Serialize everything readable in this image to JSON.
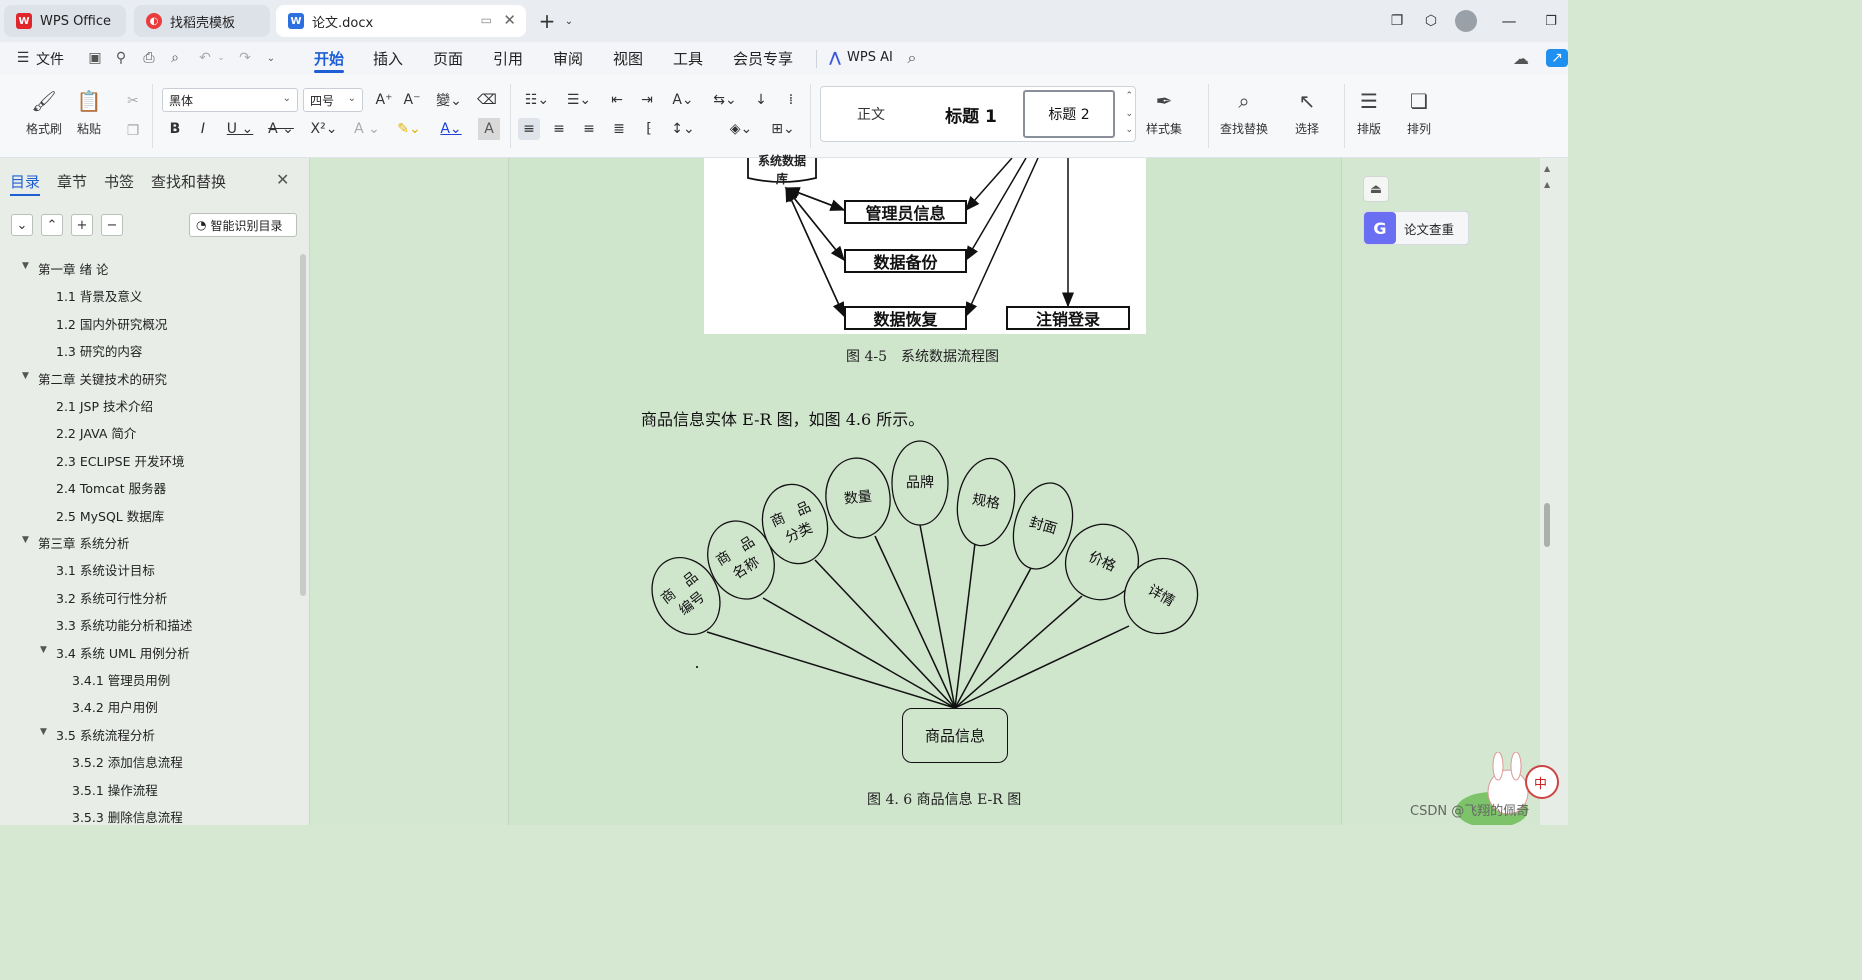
{
  "titlebar": {
    "tabs": [
      {
        "label": "WPS Office",
        "icon": "wps-logo-icon"
      },
      {
        "label": "找稻壳模板",
        "icon": "daoke-icon"
      },
      {
        "label": "论文.docx",
        "icon": "word-doc-icon"
      }
    ],
    "new_tab": "+"
  },
  "menubar": {
    "file": "文件",
    "tabs": [
      "开始",
      "插入",
      "页面",
      "引用",
      "审阅",
      "视图",
      "工具",
      "会员专享"
    ],
    "selected_tab": "开始",
    "wps_ai": "WPS AI"
  },
  "ribbon": {
    "format_painter": "格式刷",
    "paste": "粘贴",
    "font_name": "黑体",
    "font_size": "四号",
    "styles": {
      "normal": "正文",
      "h1": "标题 1",
      "h2": "标题 2"
    },
    "style_set": "样式集",
    "find_replace": "查找替换",
    "select": "选择",
    "layout": "排版",
    "arrange": "排列"
  },
  "left_panel": {
    "tabs": [
      "目录",
      "章节",
      "书签",
      "查找和替换"
    ],
    "selected_tab": "目录",
    "smart_toc": "智能识别目录",
    "toc": [
      {
        "text": "第一章 绪 论",
        "level": 1,
        "expanded": true
      },
      {
        "text": "1.1 背景及意义",
        "level": 2
      },
      {
        "text": "1.2 国内外研究概况",
        "level": 2
      },
      {
        "text": "1.3 研究的内容",
        "level": 2
      },
      {
        "text": "第二章 关键技术的研究",
        "level": 1,
        "expanded": true
      },
      {
        "text": "2.1 JSP 技术介绍",
        "level": 2
      },
      {
        "text": "2.2 JAVA 简介",
        "level": 2
      },
      {
        "text": "2.3 ECLIPSE 开发环境",
        "level": 2
      },
      {
        "text": "2.4 Tomcat 服务器",
        "level": 2
      },
      {
        "text": "2.5 MySQL 数据库",
        "level": 2
      },
      {
        "text": "第三章 系统分析",
        "level": 1,
        "expanded": true
      },
      {
        "text": "3.1 系统设计目标",
        "level": 2
      },
      {
        "text": "3.2 系统可行性分析",
        "level": 2
      },
      {
        "text": "3.3 系统功能分析和描述",
        "level": 2
      },
      {
        "text": "3.4 系统 UML 用例分析",
        "level": 2,
        "expanded": true
      },
      {
        "text": "3.4.1 管理员用例",
        "level": 3
      },
      {
        "text": "3.4.2 用户用例",
        "level": 3
      },
      {
        "text": "3.5 系统流程分析",
        "level": 2,
        "expanded": true
      },
      {
        "text": "3.5.2 添加信息流程",
        "level": 3
      },
      {
        "text": "3.5.1 操作流程",
        "level": 3
      },
      {
        "text": "3.5.3 删除信息流程",
        "level": 3
      }
    ]
  },
  "document": {
    "fig45": {
      "db_label_1": "系统数据",
      "db_label_2": "库",
      "boxes": [
        "管理员信息",
        "数据备份",
        "数据恢复",
        "注销登录"
      ],
      "caption": "图 4-5　系统数据流程图"
    },
    "paragraph": "商品信息实体 E-R 图，如图 4.6 所示。",
    "fig46": {
      "entity": "商品信息",
      "attributes": [
        [
          "商　品",
          "编号"
        ],
        [
          "商　品",
          "名称"
        ],
        [
          "商　品",
          "分类"
        ],
        [
          "数量"
        ],
        [
          "品牌"
        ],
        [
          "规格"
        ],
        [
          "封面"
        ],
        [
          "价格"
        ],
        [
          "详情"
        ]
      ],
      "caption": "图 4. 6 商品信息 E-R 图"
    }
  },
  "right_panel": {
    "paper_check": "论文查重"
  },
  "watermark": "CSDN @飞翔的佩奇",
  "colors": {
    "accent": "#1f5fd6",
    "page_bg": "#cfe5cc",
    "panel_bg": "#e8ede8"
  }
}
